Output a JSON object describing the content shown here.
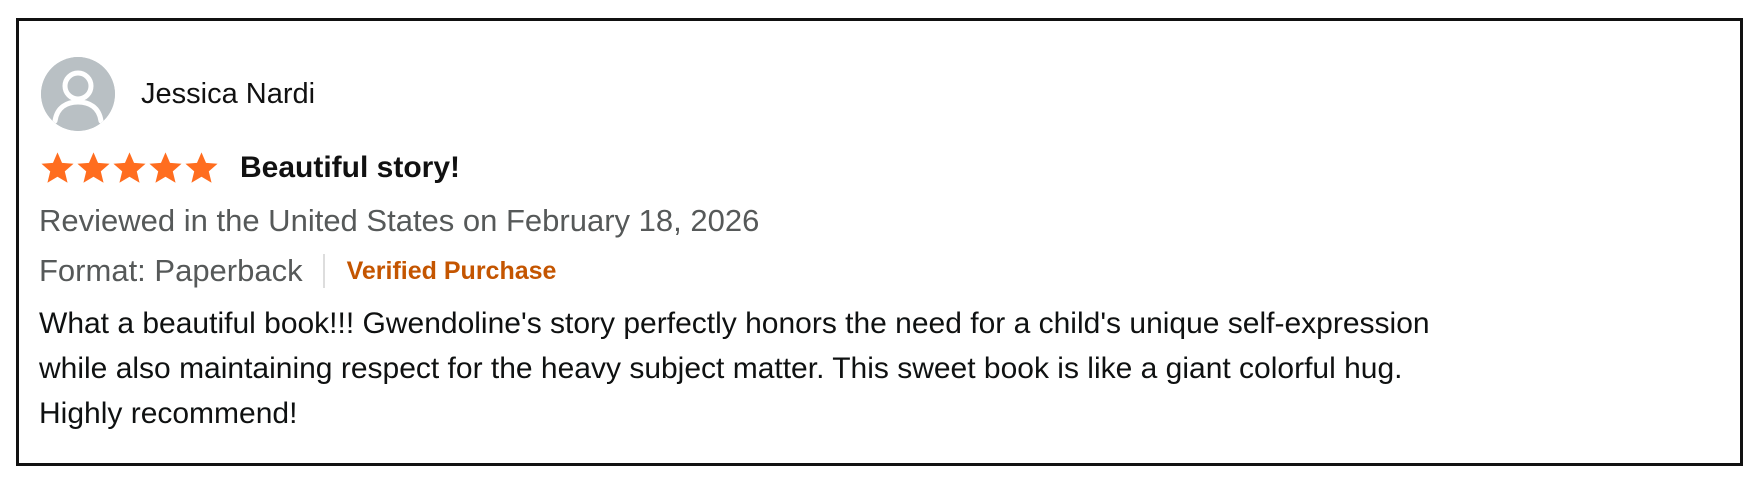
{
  "review": {
    "reviewer_name": "Jessica Nardi",
    "avatar_icon": "default-user-avatar-icon",
    "rating": 5,
    "rating_max": 5,
    "star_icon": "star-filled-icon",
    "title": "Beautiful story!",
    "reviewed_text": "Reviewed in the United States on February 18, 2026",
    "format_text": "Format: Paperback",
    "verified_label": "Verified Purchase",
    "body_lines": [
      "What a beautiful book!!! Gwendoline's story perfectly honors the need for a child's unique self-expression",
      "while also maintaining respect for the heavy subject matter. This sweet book is like a giant colorful hug.",
      "Highly recommend!"
    ]
  },
  "colors": {
    "star": "#ff6d1f",
    "verified": "#c45500",
    "secondary_text": "#565959",
    "avatar_bg": "#b9c0c4",
    "avatar_fg": "#ffffff"
  }
}
